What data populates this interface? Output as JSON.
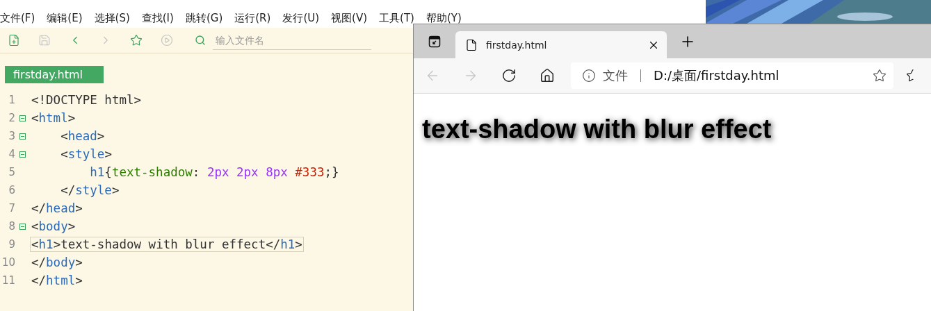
{
  "editor": {
    "menu": [
      {
        "label": "文件(F)"
      },
      {
        "label": "编辑(E)"
      },
      {
        "label": "选择(S)"
      },
      {
        "label": "查找(I)"
      },
      {
        "label": "跳转(G)"
      },
      {
        "label": "运行(R)"
      },
      {
        "label": "发行(U)"
      },
      {
        "label": "视图(V)"
      },
      {
        "label": "工具(T)"
      },
      {
        "label": "帮助(Y)"
      }
    ],
    "toolbar": [
      {
        "kind": "new",
        "disabled": false
      },
      {
        "kind": "save",
        "disabled": true
      },
      {
        "kind": "back",
        "disabled": false
      },
      {
        "kind": "forward",
        "disabled": true
      },
      {
        "kind": "star",
        "disabled": false
      },
      {
        "kind": "run",
        "disabled": true
      }
    ],
    "search": {
      "placeholder": "输入文件名"
    },
    "file_tab": {
      "label": "firstday.html",
      "selected": true
    },
    "lines": [
      {
        "number": "1",
        "fold": false,
        "current": false,
        "tokens": [
          {
            "kind": "plain",
            "text": "<!DOCTYPE html>"
          }
        ]
      },
      {
        "number": "2",
        "fold": true,
        "current": false,
        "tokens": [
          {
            "kind": "punct",
            "text": "<"
          },
          {
            "kind": "tag",
            "text": "html"
          },
          {
            "kind": "punct",
            "text": ">"
          }
        ]
      },
      {
        "number": "3",
        "fold": true,
        "current": false,
        "tokens": [
          {
            "kind": "punct",
            "text": "    <"
          },
          {
            "kind": "tag",
            "text": "head"
          },
          {
            "kind": "punct",
            "text": ">"
          }
        ]
      },
      {
        "number": "4",
        "fold": true,
        "current": false,
        "tokens": [
          {
            "kind": "punct",
            "text": "    <"
          },
          {
            "kind": "tag",
            "text": "style"
          },
          {
            "kind": "punct",
            "text": ">"
          }
        ]
      },
      {
        "number": "5",
        "fold": false,
        "current": false,
        "tokens": [
          {
            "kind": "tag",
            "text": "        h1"
          },
          {
            "kind": "punct",
            "text": "{"
          },
          {
            "kind": "prop",
            "text": "text-shadow"
          },
          {
            "kind": "punct",
            "text": ": "
          },
          {
            "kind": "num",
            "text": "2px 2px 8px "
          },
          {
            "kind": "color",
            "text": "#333"
          },
          {
            "kind": "punct",
            "text": ";}"
          }
        ]
      },
      {
        "number": "6",
        "fold": false,
        "current": false,
        "tokens": [
          {
            "kind": "punct",
            "text": "    </"
          },
          {
            "kind": "tag",
            "text": "style"
          },
          {
            "kind": "punct",
            "text": ">"
          }
        ]
      },
      {
        "number": "7",
        "fold": false,
        "current": false,
        "tokens": [
          {
            "kind": "punct",
            "text": "</"
          },
          {
            "kind": "tag",
            "text": "head"
          },
          {
            "kind": "punct",
            "text": ">"
          }
        ]
      },
      {
        "number": "8",
        "fold": true,
        "current": false,
        "tokens": [
          {
            "kind": "punct",
            "text": "<"
          },
          {
            "kind": "tag",
            "text": "body"
          },
          {
            "kind": "punct",
            "text": ">"
          }
        ]
      },
      {
        "number": "9",
        "fold": false,
        "current": true,
        "tokens": [
          {
            "kind": "punct",
            "text": "<"
          },
          {
            "kind": "tag",
            "text": "h1"
          },
          {
            "kind": "punct",
            "text": ">text-shadow with blur effect</"
          },
          {
            "kind": "tag",
            "text": "h1"
          },
          {
            "kind": "punct",
            "text": ">"
          }
        ]
      },
      {
        "number": "10",
        "fold": false,
        "current": false,
        "tokens": [
          {
            "kind": "punct",
            "text": "</"
          },
          {
            "kind": "tag",
            "text": "body"
          },
          {
            "kind": "punct",
            "text": ">"
          }
        ]
      },
      {
        "number": "11",
        "fold": false,
        "current": false,
        "tokens": [
          {
            "kind": "punct",
            "text": "</"
          },
          {
            "kind": "tag",
            "text": "html"
          },
          {
            "kind": "punct",
            "text": ">"
          }
        ]
      }
    ]
  },
  "browser": {
    "tab": {
      "title": "firstday.html",
      "selected": true
    },
    "nav": [
      {
        "kind": "back",
        "disabled": true
      },
      {
        "kind": "forward",
        "disabled": true
      },
      {
        "kind": "reload",
        "disabled": false
      },
      {
        "kind": "home",
        "disabled": false
      }
    ],
    "address": {
      "scheme": "文件",
      "url": "D:/桌面/firstday.html"
    },
    "page": {
      "heading": "text-shadow with blur effect"
    }
  }
}
